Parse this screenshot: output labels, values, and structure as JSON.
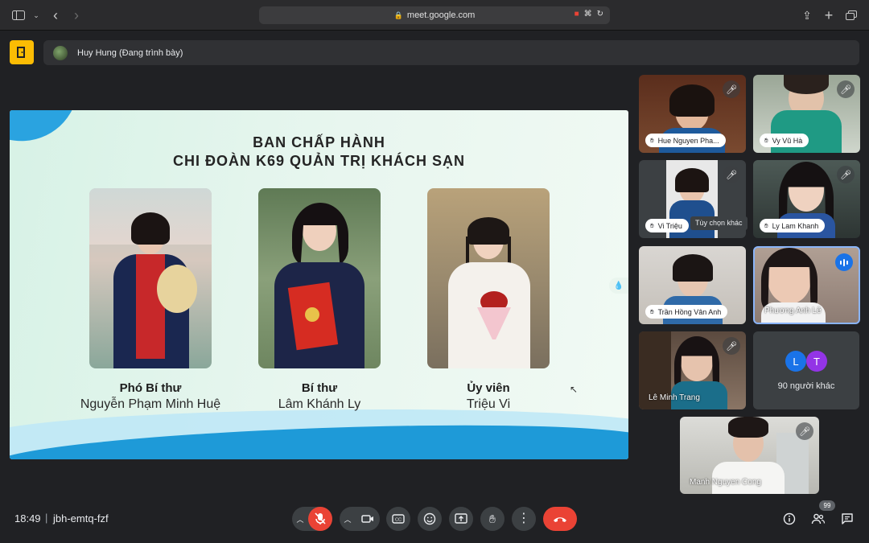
{
  "browser": {
    "url": "meet.google.com"
  },
  "presenter": {
    "text": "Huy Hung (Đang trình bày)"
  },
  "slide": {
    "title_line1": "BAN CHẤP HÀNH",
    "title_line2": "CHI ĐOÀN K69 QUẢN TRỊ KHÁCH SẠN",
    "members": [
      {
        "role": "Phó Bí thư",
        "name": "Nguyễn Phạm Minh Huệ"
      },
      {
        "role": "Bí thư",
        "name": "Lâm Khánh Ly"
      },
      {
        "role": "Ủy viên",
        "name": "Triệu Vi"
      }
    ]
  },
  "participants": [
    {
      "name": "Hue Nguyen Pha..."
    },
    {
      "name": "Vy Vũ Hà"
    },
    {
      "name": "Vi Triệu"
    },
    {
      "name": "Ly Lam Khanh"
    },
    {
      "name": "Trần Hồng Vân Anh"
    },
    {
      "name": "Phương Anh Lê"
    },
    {
      "name": "Lê Minh Trang"
    },
    {
      "name": "Manh Nguyen Cong"
    }
  ],
  "tooltip": "Tùy chọn khác",
  "others": {
    "avatars": [
      "L",
      "T"
    ],
    "text": "90 người khác",
    "colors": [
      "#1a73e8",
      "#9334e6"
    ]
  },
  "meeting": {
    "time": "18:49",
    "separator": "|",
    "code": "jbh-emtq-fzf",
    "participant_count": "99"
  },
  "colors": {
    "hangup": "#ea4335",
    "speaking": "#1a73e8",
    "exit": "#fbbc04"
  }
}
